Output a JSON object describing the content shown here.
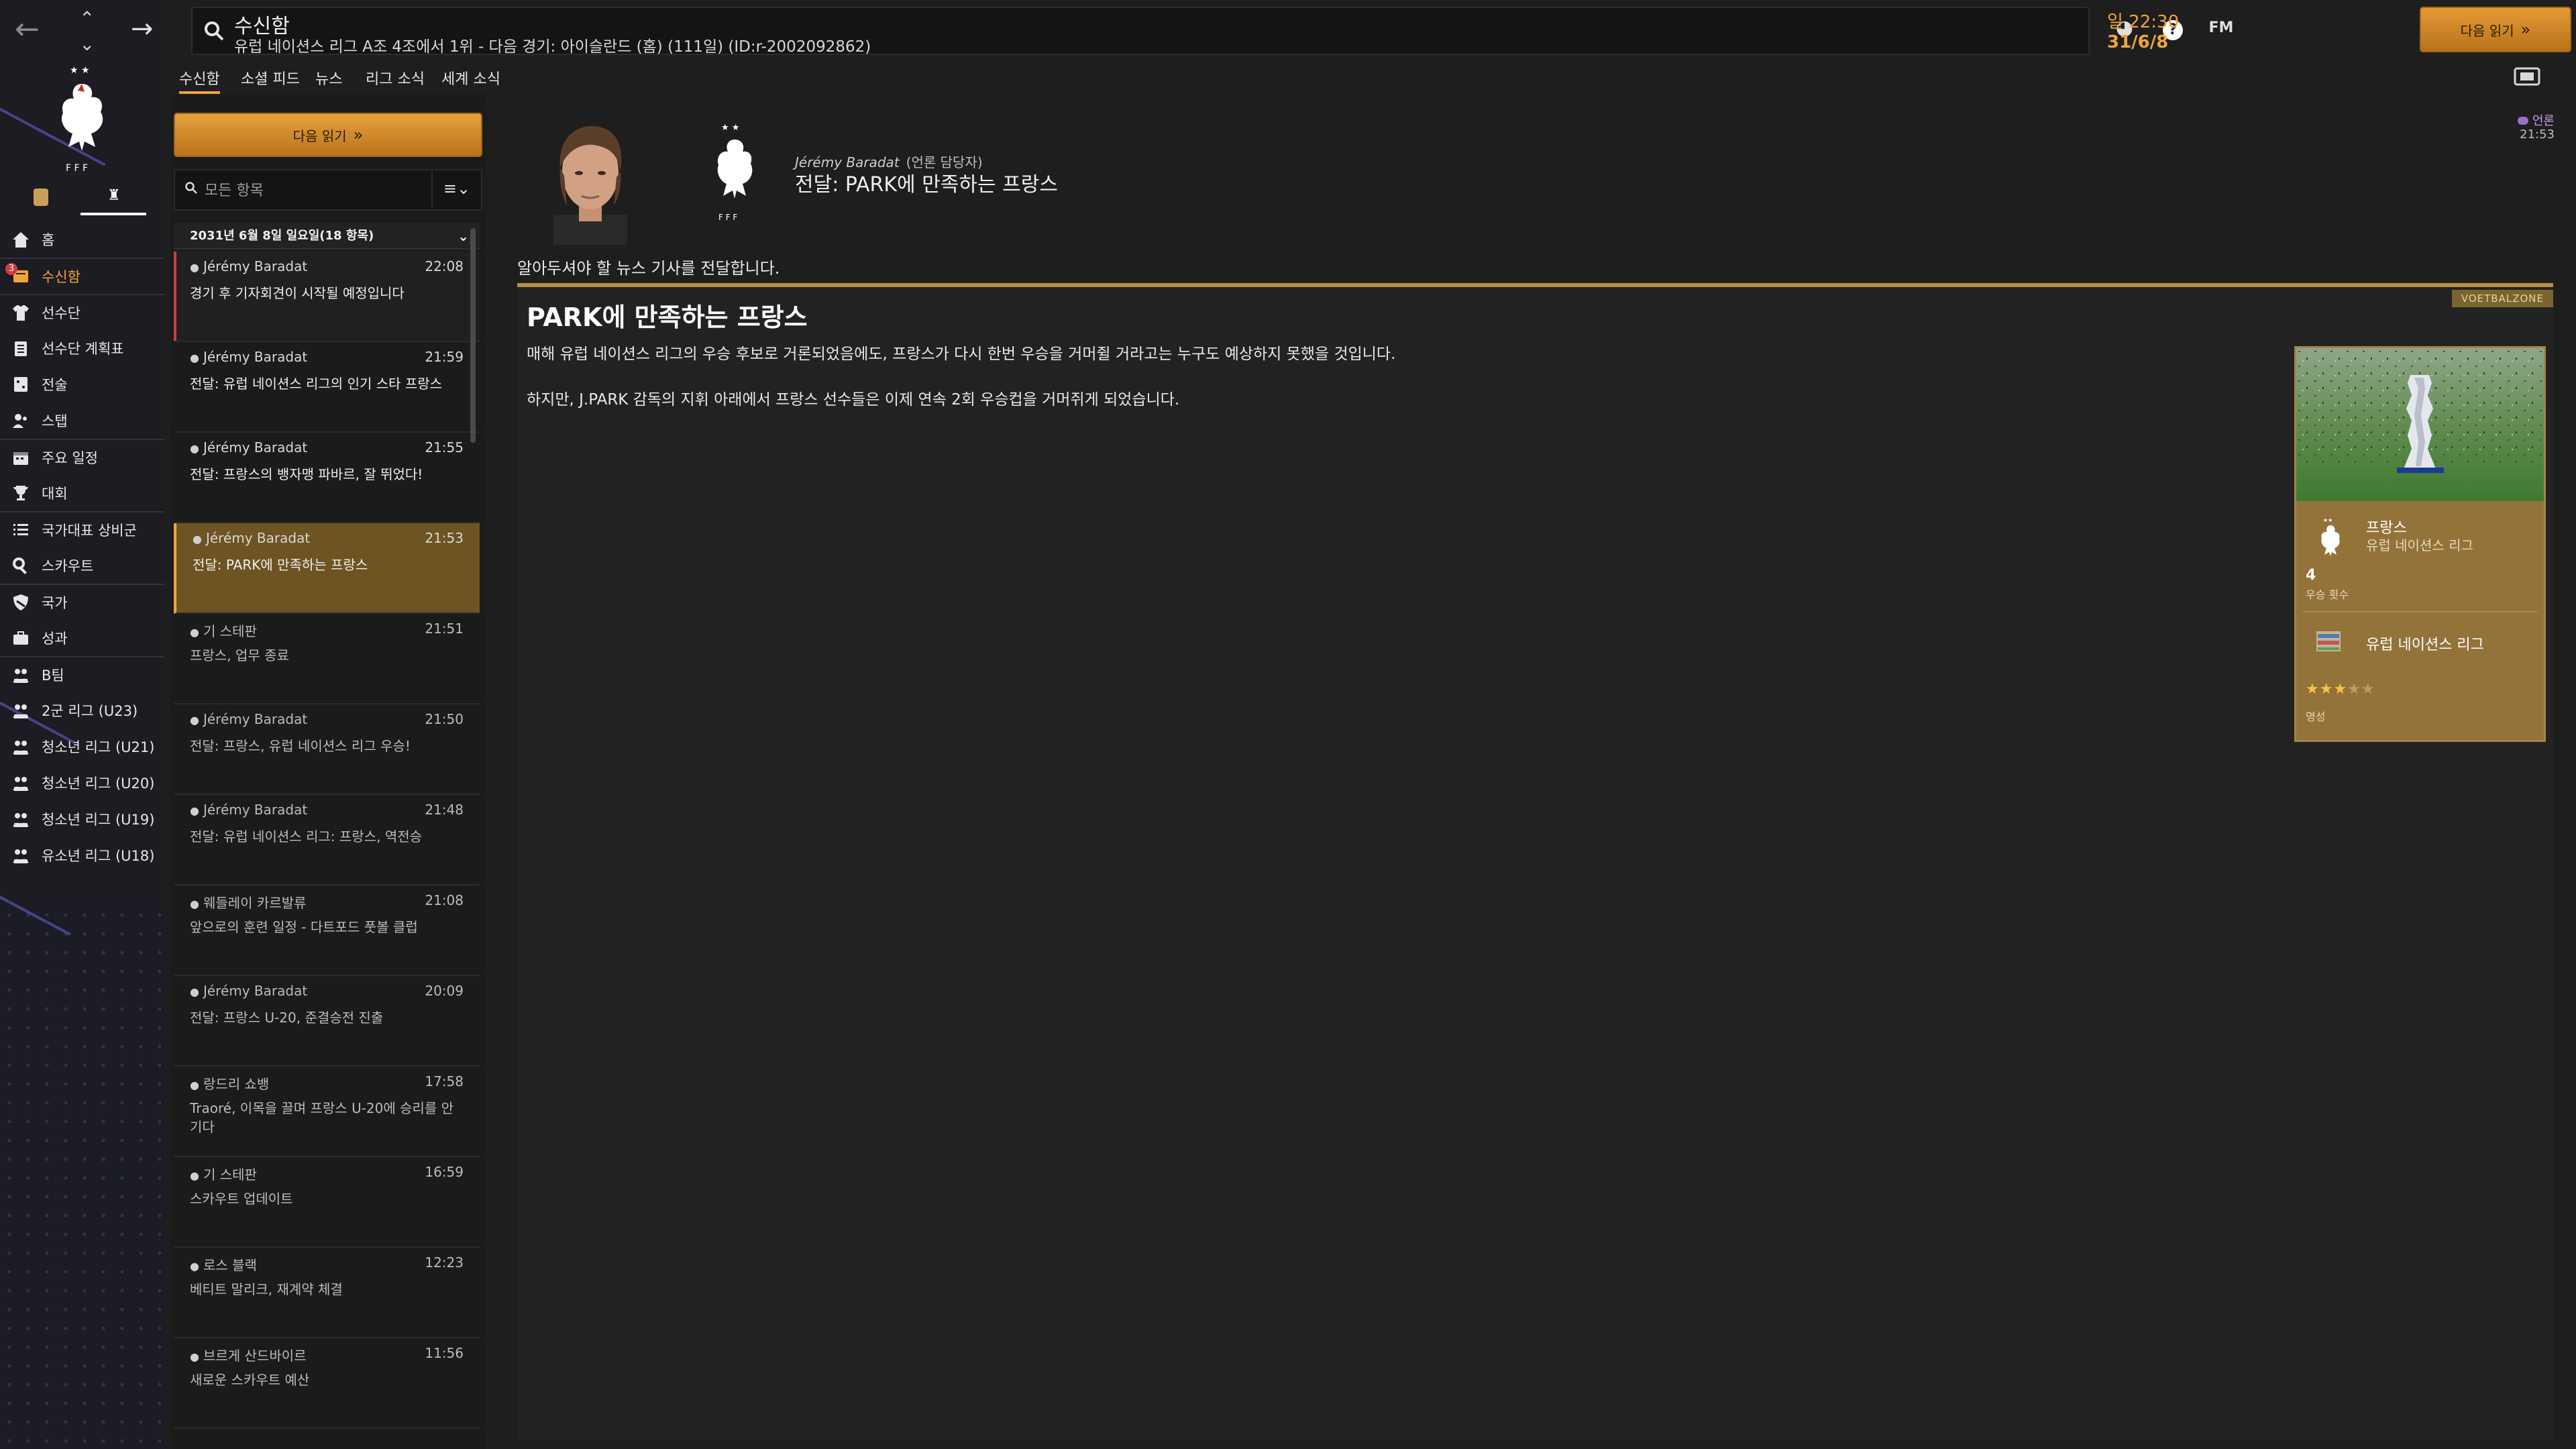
{
  "topbar": {
    "title": "수신함",
    "subtitle": "유럽 네이션스 리그 A조 4조에서 1위 - 다음 경기: 아이슬란드 (홈) (111일) (ID:r-2002092862)",
    "clock_time": "일 22:30",
    "clock_date": "31/6/8",
    "continue_label": "다음 읽기",
    "fm_label": "FM",
    "help_label": "?"
  },
  "sidebar": {
    "items": [
      {
        "label": "홈",
        "icon": "home-icon"
      },
      {
        "label": "수신함",
        "icon": "inbox-icon",
        "active": true,
        "badge": "3"
      },
      {
        "label": "선수단",
        "icon": "shirt-icon"
      },
      {
        "label": "선수단 계획표",
        "icon": "clipboard-icon"
      },
      {
        "label": "전술",
        "icon": "tactics-icon"
      },
      {
        "label": "스탭",
        "icon": "staff-icon"
      },
      {
        "label": "주요 일정",
        "icon": "calendar-icon"
      },
      {
        "label": "대회",
        "icon": "trophy-icon"
      },
      {
        "label": "국가대표 상비군",
        "icon": "list-icon"
      },
      {
        "label": "스카우트",
        "icon": "search-icon"
      },
      {
        "label": "국가",
        "icon": "shield-icon"
      },
      {
        "label": "성과",
        "icon": "briefcase-icon"
      },
      {
        "label": "B팀",
        "icon": "team-icon"
      },
      {
        "label": "2군 리그 (U23)",
        "icon": "team-icon"
      },
      {
        "label": "청소년 리그 (U21)",
        "icon": "team-icon"
      },
      {
        "label": "청소년 리그 (U20)",
        "icon": "team-icon"
      },
      {
        "label": "청소년 리그 (U19)",
        "icon": "team-icon"
      },
      {
        "label": "유소년 리그 (U18)",
        "icon": "team-icon"
      }
    ]
  },
  "tabs": [
    {
      "label": "수신함",
      "active": true
    },
    {
      "label": "소셜 피드"
    },
    {
      "label": "뉴스"
    },
    {
      "label": "리그 소식"
    },
    {
      "label": "세계 소식"
    }
  ],
  "list": {
    "next_label": "다음 읽기",
    "filter_placeholder": "모든 항목",
    "date_header": "2031년 6월 8일 일요일(18 항목)",
    "messages": [
      {
        "sender": "Jérémy Baradat",
        "time": "22:08",
        "subject": "경기 후 기자회견이 시작될 예정입니다",
        "state": "unread"
      },
      {
        "sender": "Jérémy Baradat",
        "time": "21:59",
        "subject": "전달: 유럽 네이션스 리그의 인기 스타 프랑스",
        "state": "normal"
      },
      {
        "sender": "Jérémy Baradat",
        "time": "21:55",
        "subject": "전달: 프랑스의 뱅자맹 파바르, 잘 뛰었다!",
        "state": "normal"
      },
      {
        "sender": "Jérémy Baradat",
        "time": "21:53",
        "subject": "전달: PARK에 만족하는 프랑스",
        "state": "selected"
      },
      {
        "sender": "기 스테판",
        "time": "21:51",
        "subject": "프랑스, 업무 종료",
        "state": "read"
      },
      {
        "sender": "Jérémy Baradat",
        "time": "21:50",
        "subject": "전달: 프랑스, 유럽 네이션스 리그 우승!",
        "state": "read"
      },
      {
        "sender": "Jérémy Baradat",
        "time": "21:48",
        "subject": "전달: 유럽 네이션스 리그: 프랑스, 역전승",
        "state": "read"
      },
      {
        "sender": "웨들레이 카르발류",
        "time": "21:08",
        "subject": "앞으로의 훈련 일정 - 다트포드 풋볼 클럽",
        "state": "read"
      },
      {
        "sender": "Jérémy Baradat",
        "time": "20:09",
        "subject": "전달: 프랑스 U-20, 준결승전 진출",
        "state": "read"
      },
      {
        "sender": "랑드리 쇼뱅",
        "time": "17:58",
        "subject": "Traoré, 이목을 끌며 프랑스 U-20에 승리를 안기다",
        "state": "read"
      },
      {
        "sender": "기 스테판",
        "time": "16:59",
        "subject": "스카우트 업데이트",
        "state": "read"
      },
      {
        "sender": "로스 블랙",
        "time": "12:23",
        "subject": "베티트 말리크, 재계약 체결",
        "state": "read"
      },
      {
        "sender": "브르게 산드바이르",
        "time": "11:56",
        "subject": "새로운 스카우트 예산",
        "state": "read"
      }
    ]
  },
  "detail": {
    "sender_name": "Jérémy Baradat",
    "sender_role": "(언론 담당자)",
    "title": "전달: PARK에 만족하는 프랑스",
    "flag_label": "언론",
    "time": "21:53",
    "intro": "알아두셔야 할 뉴스 기사를 전달합니다.",
    "source": "VOETBALZONE",
    "headline": "PARK에 만족하는 프랑스",
    "p1": "매해 유럽 네이션스 리그의 우승 후보로 거론되었음에도, 프랑스가 다시 한번 우승을 거머쥘 거라고는 누구도 예상하지 못했을 것입니다.",
    "p2": "하지만, J.PARK 감독의 지휘 아래에서 프랑스 선수들은 이제 연속 2회 우승컵을 거머쥐게 되었습니다.",
    "card": {
      "team": "프랑스",
      "competition": "유럽 네이션스 리그",
      "titles_count": "4",
      "titles_label": "우승 횟수",
      "competition2": "유럽 네이션스 리그",
      "stars": "★★★",
      "stars_dim": "★★",
      "reputation_label": "명성"
    }
  },
  "colors": {
    "accent": "#f0a53a",
    "card": "#94733a",
    "sidebar": "#1c1c22"
  }
}
